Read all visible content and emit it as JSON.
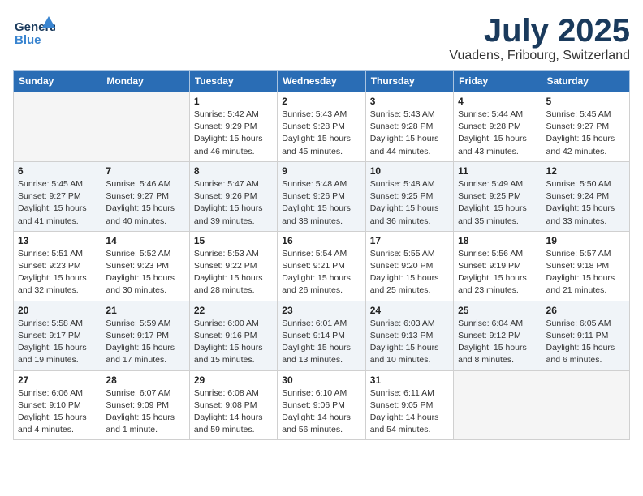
{
  "header": {
    "logo_line1": "General",
    "logo_line2": "Blue",
    "month": "July 2025",
    "location": "Vuadens, Fribourg, Switzerland"
  },
  "weekdays": [
    "Sunday",
    "Monday",
    "Tuesday",
    "Wednesday",
    "Thursday",
    "Friday",
    "Saturday"
  ],
  "weeks": [
    [
      {
        "day": "",
        "info": ""
      },
      {
        "day": "",
        "info": ""
      },
      {
        "day": "1",
        "info": "Sunrise: 5:42 AM\nSunset: 9:29 PM\nDaylight: 15 hours\nand 46 minutes."
      },
      {
        "day": "2",
        "info": "Sunrise: 5:43 AM\nSunset: 9:28 PM\nDaylight: 15 hours\nand 45 minutes."
      },
      {
        "day": "3",
        "info": "Sunrise: 5:43 AM\nSunset: 9:28 PM\nDaylight: 15 hours\nand 44 minutes."
      },
      {
        "day": "4",
        "info": "Sunrise: 5:44 AM\nSunset: 9:28 PM\nDaylight: 15 hours\nand 43 minutes."
      },
      {
        "day": "5",
        "info": "Sunrise: 5:45 AM\nSunset: 9:27 PM\nDaylight: 15 hours\nand 42 minutes."
      }
    ],
    [
      {
        "day": "6",
        "info": "Sunrise: 5:45 AM\nSunset: 9:27 PM\nDaylight: 15 hours\nand 41 minutes."
      },
      {
        "day": "7",
        "info": "Sunrise: 5:46 AM\nSunset: 9:27 PM\nDaylight: 15 hours\nand 40 minutes."
      },
      {
        "day": "8",
        "info": "Sunrise: 5:47 AM\nSunset: 9:26 PM\nDaylight: 15 hours\nand 39 minutes."
      },
      {
        "day": "9",
        "info": "Sunrise: 5:48 AM\nSunset: 9:26 PM\nDaylight: 15 hours\nand 38 minutes."
      },
      {
        "day": "10",
        "info": "Sunrise: 5:48 AM\nSunset: 9:25 PM\nDaylight: 15 hours\nand 36 minutes."
      },
      {
        "day": "11",
        "info": "Sunrise: 5:49 AM\nSunset: 9:25 PM\nDaylight: 15 hours\nand 35 minutes."
      },
      {
        "day": "12",
        "info": "Sunrise: 5:50 AM\nSunset: 9:24 PM\nDaylight: 15 hours\nand 33 minutes."
      }
    ],
    [
      {
        "day": "13",
        "info": "Sunrise: 5:51 AM\nSunset: 9:23 PM\nDaylight: 15 hours\nand 32 minutes."
      },
      {
        "day": "14",
        "info": "Sunrise: 5:52 AM\nSunset: 9:23 PM\nDaylight: 15 hours\nand 30 minutes."
      },
      {
        "day": "15",
        "info": "Sunrise: 5:53 AM\nSunset: 9:22 PM\nDaylight: 15 hours\nand 28 minutes."
      },
      {
        "day": "16",
        "info": "Sunrise: 5:54 AM\nSunset: 9:21 PM\nDaylight: 15 hours\nand 26 minutes."
      },
      {
        "day": "17",
        "info": "Sunrise: 5:55 AM\nSunset: 9:20 PM\nDaylight: 15 hours\nand 25 minutes."
      },
      {
        "day": "18",
        "info": "Sunrise: 5:56 AM\nSunset: 9:19 PM\nDaylight: 15 hours\nand 23 minutes."
      },
      {
        "day": "19",
        "info": "Sunrise: 5:57 AM\nSunset: 9:18 PM\nDaylight: 15 hours\nand 21 minutes."
      }
    ],
    [
      {
        "day": "20",
        "info": "Sunrise: 5:58 AM\nSunset: 9:17 PM\nDaylight: 15 hours\nand 19 minutes."
      },
      {
        "day": "21",
        "info": "Sunrise: 5:59 AM\nSunset: 9:17 PM\nDaylight: 15 hours\nand 17 minutes."
      },
      {
        "day": "22",
        "info": "Sunrise: 6:00 AM\nSunset: 9:16 PM\nDaylight: 15 hours\nand 15 minutes."
      },
      {
        "day": "23",
        "info": "Sunrise: 6:01 AM\nSunset: 9:14 PM\nDaylight: 15 hours\nand 13 minutes."
      },
      {
        "day": "24",
        "info": "Sunrise: 6:03 AM\nSunset: 9:13 PM\nDaylight: 15 hours\nand 10 minutes."
      },
      {
        "day": "25",
        "info": "Sunrise: 6:04 AM\nSunset: 9:12 PM\nDaylight: 15 hours\nand 8 minutes."
      },
      {
        "day": "26",
        "info": "Sunrise: 6:05 AM\nSunset: 9:11 PM\nDaylight: 15 hours\nand 6 minutes."
      }
    ],
    [
      {
        "day": "27",
        "info": "Sunrise: 6:06 AM\nSunset: 9:10 PM\nDaylight: 15 hours\nand 4 minutes."
      },
      {
        "day": "28",
        "info": "Sunrise: 6:07 AM\nSunset: 9:09 PM\nDaylight: 15 hours\nand 1 minute."
      },
      {
        "day": "29",
        "info": "Sunrise: 6:08 AM\nSunset: 9:08 PM\nDaylight: 14 hours\nand 59 minutes."
      },
      {
        "day": "30",
        "info": "Sunrise: 6:10 AM\nSunset: 9:06 PM\nDaylight: 14 hours\nand 56 minutes."
      },
      {
        "day": "31",
        "info": "Sunrise: 6:11 AM\nSunset: 9:05 PM\nDaylight: 14 hours\nand 54 minutes."
      },
      {
        "day": "",
        "info": ""
      },
      {
        "day": "",
        "info": ""
      }
    ]
  ]
}
